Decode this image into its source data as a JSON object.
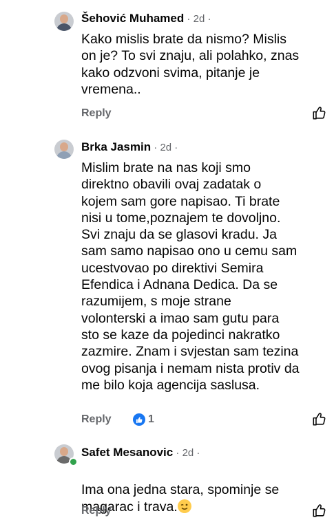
{
  "comments": [
    {
      "author": "Šehović Muhamed",
      "meta": " · 2d ·",
      "text": "Kako mislis brate da nismo? Mislis\non je? To svi znaju, ali polahko, znas\nkako odzvoni svima, pitanje je\nvremena..",
      "reply_label": "Reply",
      "online": false
    },
    {
      "author": "Brka Jasmin",
      "meta": " · 2d ·",
      "text": "Mislim brate na nas koji smo\ndirektno obavili ovaj zadatak o\nkojem sam gore napisao.  Ti brate\nnisi u tome,poznajem te dovoljno.\nSvi znaju da se glasovi kradu. Ja\nsam samo napisao ono u cemu sam\nucestvovao po direktivi Semira\nEfendica i Adnana Dedica. Da se\nrazumijem, s moje strane\nvolonterski a imao sam gutu para\nsto se kaze da pojedinci nakratko\nzazmire. Znam i svjestan sam tezina\novog pisanja i nemam nista protiv da\nme bilo koja agencija saslusa.",
      "reply_label": "Reply",
      "reaction_count": "1",
      "online": false
    },
    {
      "author": "Safet Mesanovic",
      "meta": " · 2d ·",
      "text": "Ima ona jedna stara, spominje se\nmagarac i trava.",
      "reply_label": "Reply",
      "online": true
    }
  ],
  "icons": {
    "like": "thumbs-up-outline-icon",
    "reaction": "like-reaction-icon",
    "emoji": "winking-face-emoji"
  },
  "colors": {
    "like_blue": "#1877f2",
    "secondary_text": "#65676b",
    "online": "#31a24c"
  }
}
